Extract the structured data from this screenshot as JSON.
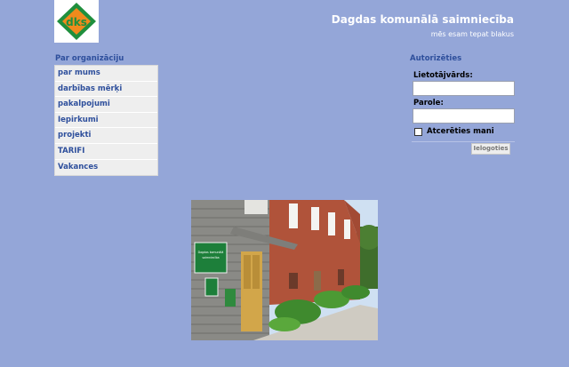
{
  "header": {
    "site_title": "Dagdas komunālā saimniecība",
    "tagline": "mēs esam tepat blakus",
    "logo_text": "dks"
  },
  "sidebar": {
    "heading": "Par organizāciju",
    "items": [
      {
        "label": "par mums"
      },
      {
        "label": "darbības mērķi"
      },
      {
        "label": "pakalpojumi"
      },
      {
        "label": "Iepirkumi"
      },
      {
        "label": "projekti"
      },
      {
        "label": "TARIFI"
      },
      {
        "label": "Vakances"
      }
    ]
  },
  "login": {
    "heading": "Autorizēties",
    "username_label": "Lietotājvārds:",
    "username_value": "",
    "password_label": "Parole:",
    "password_value": "",
    "remember_label": "Atcerēties mani",
    "remember_checked": false,
    "submit_label": "Ielogoties"
  },
  "photo": {
    "sign_text": "Dagdas komunālā saimniecība"
  },
  "colors": {
    "background": "#94a6d8",
    "menu_text": "#2e4f9c",
    "menu_bg": "#eeeeee",
    "logo_green": "#1f8f3d",
    "logo_orange": "#f08a1c"
  }
}
